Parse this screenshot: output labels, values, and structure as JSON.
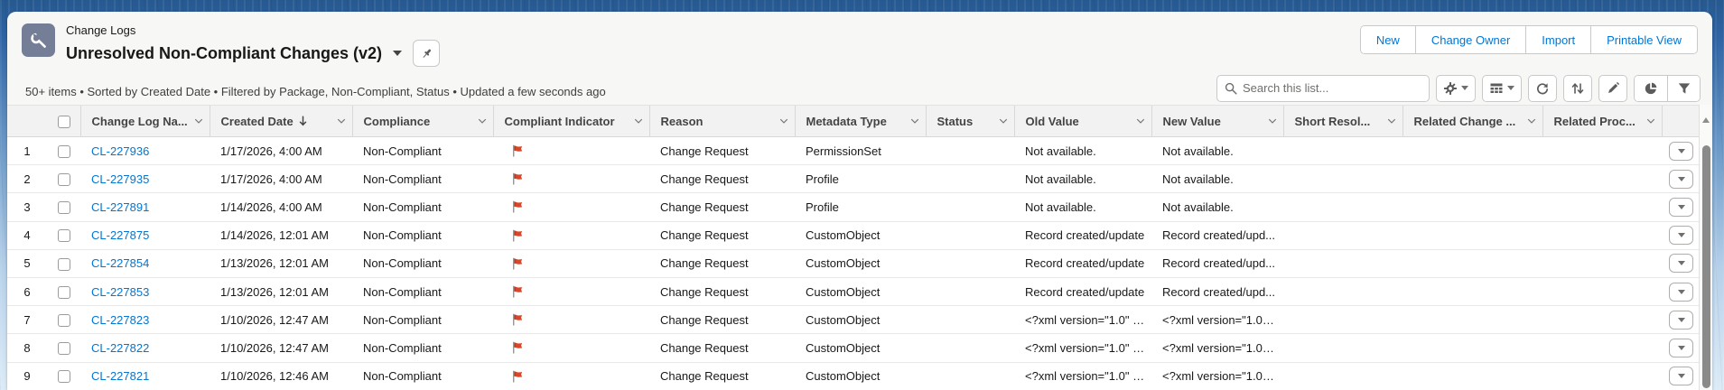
{
  "header": {
    "entity_label": "Change Logs",
    "title": "Unresolved Non-Compliant Changes (v2)",
    "actions": [
      {
        "label": "New"
      },
      {
        "label": "Change Owner"
      },
      {
        "label": "Import"
      },
      {
        "label": "Printable View"
      }
    ]
  },
  "list_meta": "50+ items • Sorted by Created Date • Filtered by Package, Non-Compliant, Status • Updated a few seconds ago",
  "search": {
    "placeholder": "Search this list..."
  },
  "toolbar_icons": [
    "settings-gear",
    "table-display",
    "refresh",
    "sort",
    "inline-edit-pencil",
    "charts-pie",
    "filter-funnel"
  ],
  "table": {
    "columns": [
      {
        "label": ""
      },
      {
        "label": ""
      },
      {
        "label": "Change Log Na..."
      },
      {
        "label": "Created Date",
        "sorted": "desc"
      },
      {
        "label": "Compliance"
      },
      {
        "label": "Compliant Indicator"
      },
      {
        "label": "Reason"
      },
      {
        "label": "Metadata Type"
      },
      {
        "label": "Status"
      },
      {
        "label": "Old Value"
      },
      {
        "label": "New Value"
      },
      {
        "label": "Short Resol..."
      },
      {
        "label": "Related Change ..."
      },
      {
        "label": "Related Proc..."
      },
      {
        "label": ""
      }
    ],
    "rows": [
      {
        "num": "1",
        "name": "CL-227936",
        "created": "1/17/2026, 4:00 AM",
        "compliance": "Non-Compliant",
        "flag": "red-flag",
        "reason": "Change Request",
        "metadata_type": "PermissionSet",
        "status": "",
        "old_value": "Not available.",
        "new_value": "Not available.",
        "short_resolution": "",
        "related_change": "",
        "related_process": ""
      },
      {
        "num": "2",
        "name": "CL-227935",
        "created": "1/17/2026, 4:00 AM",
        "compliance": "Non-Compliant",
        "flag": "red-flag",
        "reason": "Change Request",
        "metadata_type": "Profile",
        "status": "",
        "old_value": "Not available.",
        "new_value": "Not available.",
        "short_resolution": "",
        "related_change": "",
        "related_process": ""
      },
      {
        "num": "3",
        "name": "CL-227891",
        "created": "1/14/2026, 4:00 AM",
        "compliance": "Non-Compliant",
        "flag": "red-flag",
        "reason": "Change Request",
        "metadata_type": "Profile",
        "status": "",
        "old_value": "Not available.",
        "new_value": "Not available.",
        "short_resolution": "",
        "related_change": "",
        "related_process": ""
      },
      {
        "num": "4",
        "name": "CL-227875",
        "created": "1/14/2026, 12:01 AM",
        "compliance": "Non-Compliant",
        "flag": "red-flag",
        "reason": "Change Request",
        "metadata_type": "CustomObject",
        "status": "",
        "old_value": "Record created/update",
        "new_value": "Record created/upd...",
        "short_resolution": "",
        "related_change": "",
        "related_process": ""
      },
      {
        "num": "5",
        "name": "CL-227854",
        "created": "1/13/2026, 12:01 AM",
        "compliance": "Non-Compliant",
        "flag": "red-flag",
        "reason": "Change Request",
        "metadata_type": "CustomObject",
        "status": "",
        "old_value": "Record created/update",
        "new_value": "Record created/upd...",
        "short_resolution": "",
        "related_change": "",
        "related_process": ""
      },
      {
        "num": "6",
        "name": "CL-227853",
        "created": "1/13/2026, 12:01 AM",
        "compliance": "Non-Compliant",
        "flag": "red-flag",
        "reason": "Change Request",
        "metadata_type": "CustomObject",
        "status": "",
        "old_value": "Record created/update",
        "new_value": "Record created/upd...",
        "short_resolution": "",
        "related_change": "",
        "related_process": ""
      },
      {
        "num": "7",
        "name": "CL-227823",
        "created": "1/10/2026, 12:47 AM",
        "compliance": "Non-Compliant",
        "flag": "red-flag",
        "reason": "Change Request",
        "metadata_type": "CustomObject",
        "status": "",
        "old_value": "<?xml version=\"1.0\" e...",
        "new_value": "<?xml version=\"1.0\" ...",
        "short_resolution": "",
        "related_change": "",
        "related_process": ""
      },
      {
        "num": "8",
        "name": "CL-227822",
        "created": "1/10/2026, 12:47 AM",
        "compliance": "Non-Compliant",
        "flag": "red-flag",
        "reason": "Change Request",
        "metadata_type": "CustomObject",
        "status": "",
        "old_value": "<?xml version=\"1.0\" e...",
        "new_value": "<?xml version=\"1.0\" ...",
        "short_resolution": "",
        "related_change": "",
        "related_process": ""
      },
      {
        "num": "9",
        "name": "CL-227821",
        "created": "1/10/2026, 12:46 AM",
        "compliance": "Non-Compliant",
        "flag": "red-flag",
        "reason": "Change Request",
        "metadata_type": "CustomObject",
        "status": "",
        "old_value": "<?xml version=\"1.0\" e...",
        "new_value": "<?xml version=\"1.0\" ...",
        "short_resolution": "",
        "related_change": "",
        "related_process": ""
      }
    ]
  },
  "colors": {
    "accent": "#0176d3",
    "flag": "#D9472B",
    "icon_tile": "#747E96",
    "link": "#0176d3"
  }
}
